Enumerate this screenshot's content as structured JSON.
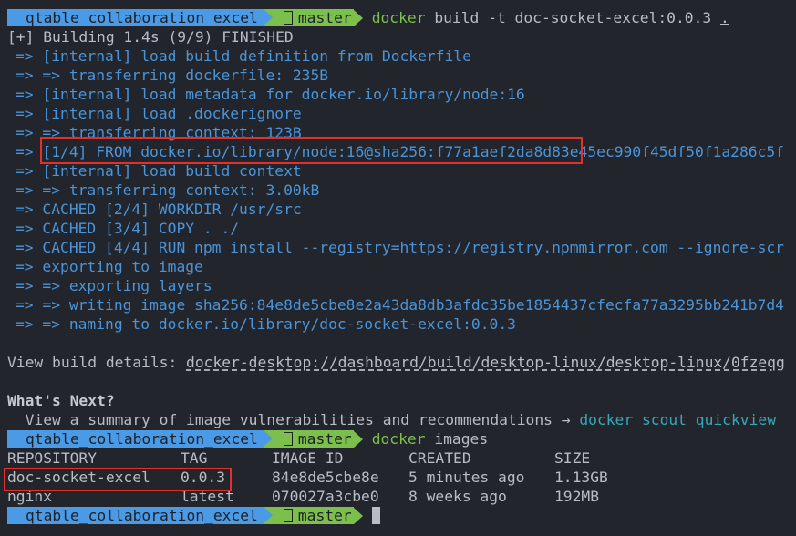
{
  "prompt": {
    "directory": "qtable_collaboration_excel",
    "branch_icon": "git-branch-icon",
    "branch": "master"
  },
  "commands": [
    {
      "cmd": "docker",
      "args": "build -t doc-socket-excel:0.0.3",
      "trailing": "."
    },
    {
      "cmd": "docker",
      "args": "images"
    }
  ],
  "build": {
    "header": "[+] Building 1.4s (9/9) FINISHED",
    "steps": [
      "=> [internal] load build definition from Dockerfile",
      "=> => transferring dockerfile: 235B",
      "=> [internal] load metadata for docker.io/library/node:16",
      "=> [internal] load .dockerignore",
      "=> => transferring context: 123B",
      "=> [1/4] FROM docker.io/library/node:16@sha256:f77a1aef2da8d83e45ec990f45df50f1a286c5f",
      "=> [internal] load build context",
      "=> => transferring context: 3.00kB",
      "=> CACHED [2/4] WORKDIR /usr/src",
      "=> CACHED [3/4] COPY . ./",
      "=> CACHED [4/4] RUN npm install --registry=https://registry.npmmirror.com --ignore-scr",
      "=> exporting to image",
      "=> => exporting layers",
      "=> => writing image sha256:84e8de5cbe8e2a43da8db3afdc35be1854437cfecfa77a3295bb241b7d4",
      "=> => naming to docker.io/library/doc-socket-excel:0.0.3"
    ],
    "details_label": "View build details: ",
    "details_link": "docker-desktop://dashboard/build/desktop-linux/desktop-linux/0fzeqg",
    "whats_next_title": "What's Next?",
    "whats_next_text": "  View a summary of image vulnerabilities and recommendations → ",
    "whats_next_cmd": "docker scout quickview"
  },
  "images_table": {
    "headers": [
      "REPOSITORY",
      "TAG",
      "IMAGE ID",
      "CREATED",
      "SIZE"
    ],
    "rows": [
      [
        "doc-socket-excel",
        "0.0.3",
        "84e8de5cbe8e",
        "5 minutes ago",
        "1.13GB"
      ],
      [
        "nginx",
        "latest",
        "070027a3cbe0",
        "8 weeks ago",
        "192MB"
      ]
    ]
  },
  "colors": {
    "background": "#22252c",
    "dir_segment": "#4b9ae6",
    "git_segment": "#7cbf4c",
    "build_text": "#4a94d9",
    "highlight_box": "#e3302b",
    "scout_cmd": "#35a8bb"
  }
}
